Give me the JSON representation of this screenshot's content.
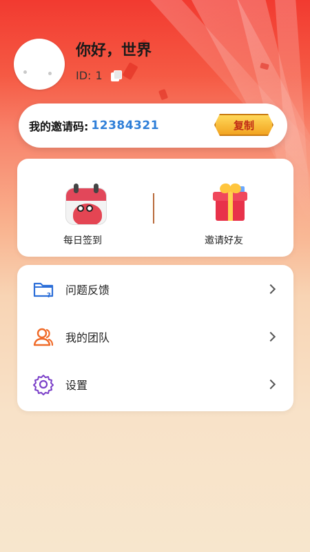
{
  "profile": {
    "greeting": "你好，世界",
    "id_label": "ID:",
    "id_value": "1"
  },
  "invite": {
    "label": "我的邀请码:",
    "code": "12384321",
    "copy_label": "复制"
  },
  "actions": [
    {
      "label": "每日签到",
      "icon": "calendar-icon"
    },
    {
      "label": "邀请好友",
      "icon": "gift-box-icon"
    }
  ],
  "menu": {
    "items": [
      {
        "label": "问题反馈",
        "icon": "folder-question-icon",
        "color": "#2b6ed8"
      },
      {
        "label": "我的团队",
        "icon": "team-users-icon",
        "color": "#f06a28"
      },
      {
        "label": "设置",
        "icon": "gear-icon",
        "color": "#7a3fc8"
      }
    ]
  },
  "colors": {
    "header_red": "#f23a30",
    "invite_code_blue": "#2f7fd8",
    "copy_button_gold": "#f2a421"
  }
}
